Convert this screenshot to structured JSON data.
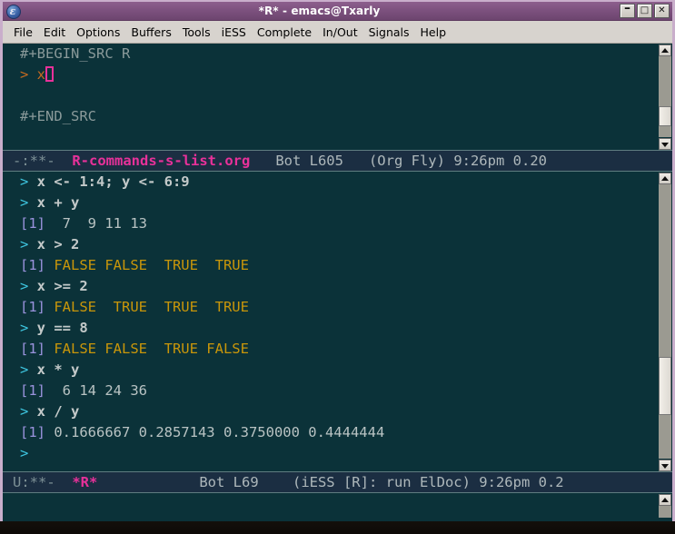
{
  "window": {
    "title": "*R* - emacs@Txarly",
    "app_icon": "emacs-icon",
    "buttons": {
      "minimize": "–",
      "maximize": "□",
      "close": "✕"
    }
  },
  "menu_bar": {
    "items": [
      {
        "label": "File"
      },
      {
        "label": "Edit"
      },
      {
        "label": "Options"
      },
      {
        "label": "Buffers"
      },
      {
        "label": "Tools"
      },
      {
        "label": "iESS"
      },
      {
        "label": "Complete"
      },
      {
        "label": "In/Out"
      },
      {
        "label": "Signals"
      },
      {
        "label": "Help"
      }
    ]
  },
  "org_buffer": {
    "lines": [
      {
        "text": "#+BEGIN_SRC R",
        "kind": "comment"
      },
      {
        "prompt": ">",
        "text": " x",
        "kind": "org-prompt",
        "cursor": true
      },
      {
        "text": "",
        "kind": "blank"
      },
      {
        "text": "#+END_SRC",
        "kind": "comment"
      },
      {
        "text": "",
        "kind": "blank"
      }
    ],
    "mode_line": {
      "flags": "-:**-",
      "buffer_name": "R-commands-s-list.org",
      "position": "Bot L605",
      "major_mode": "(Org Fly)",
      "time": "9:26pm",
      "load": "0.20"
    }
  },
  "repl_buffer": {
    "lines": [
      {
        "kind": "input",
        "prompt": "> ",
        "text": "x <- 1:4; y <- 6:9"
      },
      {
        "kind": "input",
        "prompt": "> ",
        "text": "x + y"
      },
      {
        "kind": "output",
        "index": "[1]",
        "text": "  7  9 11 13",
        "value_type": "numeric"
      },
      {
        "kind": "input",
        "prompt": "> ",
        "text": "x > 2"
      },
      {
        "kind": "output",
        "index": "[1]",
        "text": " FALSE FALSE  TRUE  TRUE",
        "value_type": "logical"
      },
      {
        "kind": "input",
        "prompt": "> ",
        "text": "x >= 2"
      },
      {
        "kind": "output",
        "index": "[1]",
        "text": " FALSE  TRUE  TRUE  TRUE",
        "value_type": "logical"
      },
      {
        "kind": "input",
        "prompt": "> ",
        "text": "y == 8"
      },
      {
        "kind": "output",
        "index": "[1]",
        "text": " FALSE FALSE  TRUE FALSE",
        "value_type": "logical"
      },
      {
        "kind": "input",
        "prompt": "> ",
        "text": "x * y"
      },
      {
        "kind": "output",
        "index": "[1]",
        "text": "  6 14 24 36",
        "value_type": "numeric"
      },
      {
        "kind": "input",
        "prompt": "> ",
        "text": "x / y"
      },
      {
        "kind": "output",
        "index": "[1]",
        "text": " 0.1666667 0.2857143 0.3750000 0.4444444",
        "value_type": "numeric"
      },
      {
        "kind": "input",
        "prompt": "> ",
        "text": ""
      }
    ],
    "mode_line": {
      "flags": "U:**-",
      "buffer_name": "*R*",
      "position": "Bot L69",
      "major_mode": "(iESS [R]: run ElDoc)",
      "time": "9:26pm",
      "load": "0.2"
    }
  },
  "scrollbars": {
    "org": {
      "arrow_up": "▲",
      "arrow_down": "▼"
    },
    "repl": {
      "arrow_up": "▲",
      "arrow_down": "▼"
    }
  },
  "colors": {
    "background": "#0b3239",
    "mode_line_bg": "#1b2e42",
    "buffer_name": "#e8319a",
    "prompt": "#3ec6e0",
    "org_prompt": "#c46a20",
    "index": "#9a93dd",
    "logical": "#c8960a",
    "title_bar": "#7a4f7c",
    "cursor": "#e8319a"
  }
}
